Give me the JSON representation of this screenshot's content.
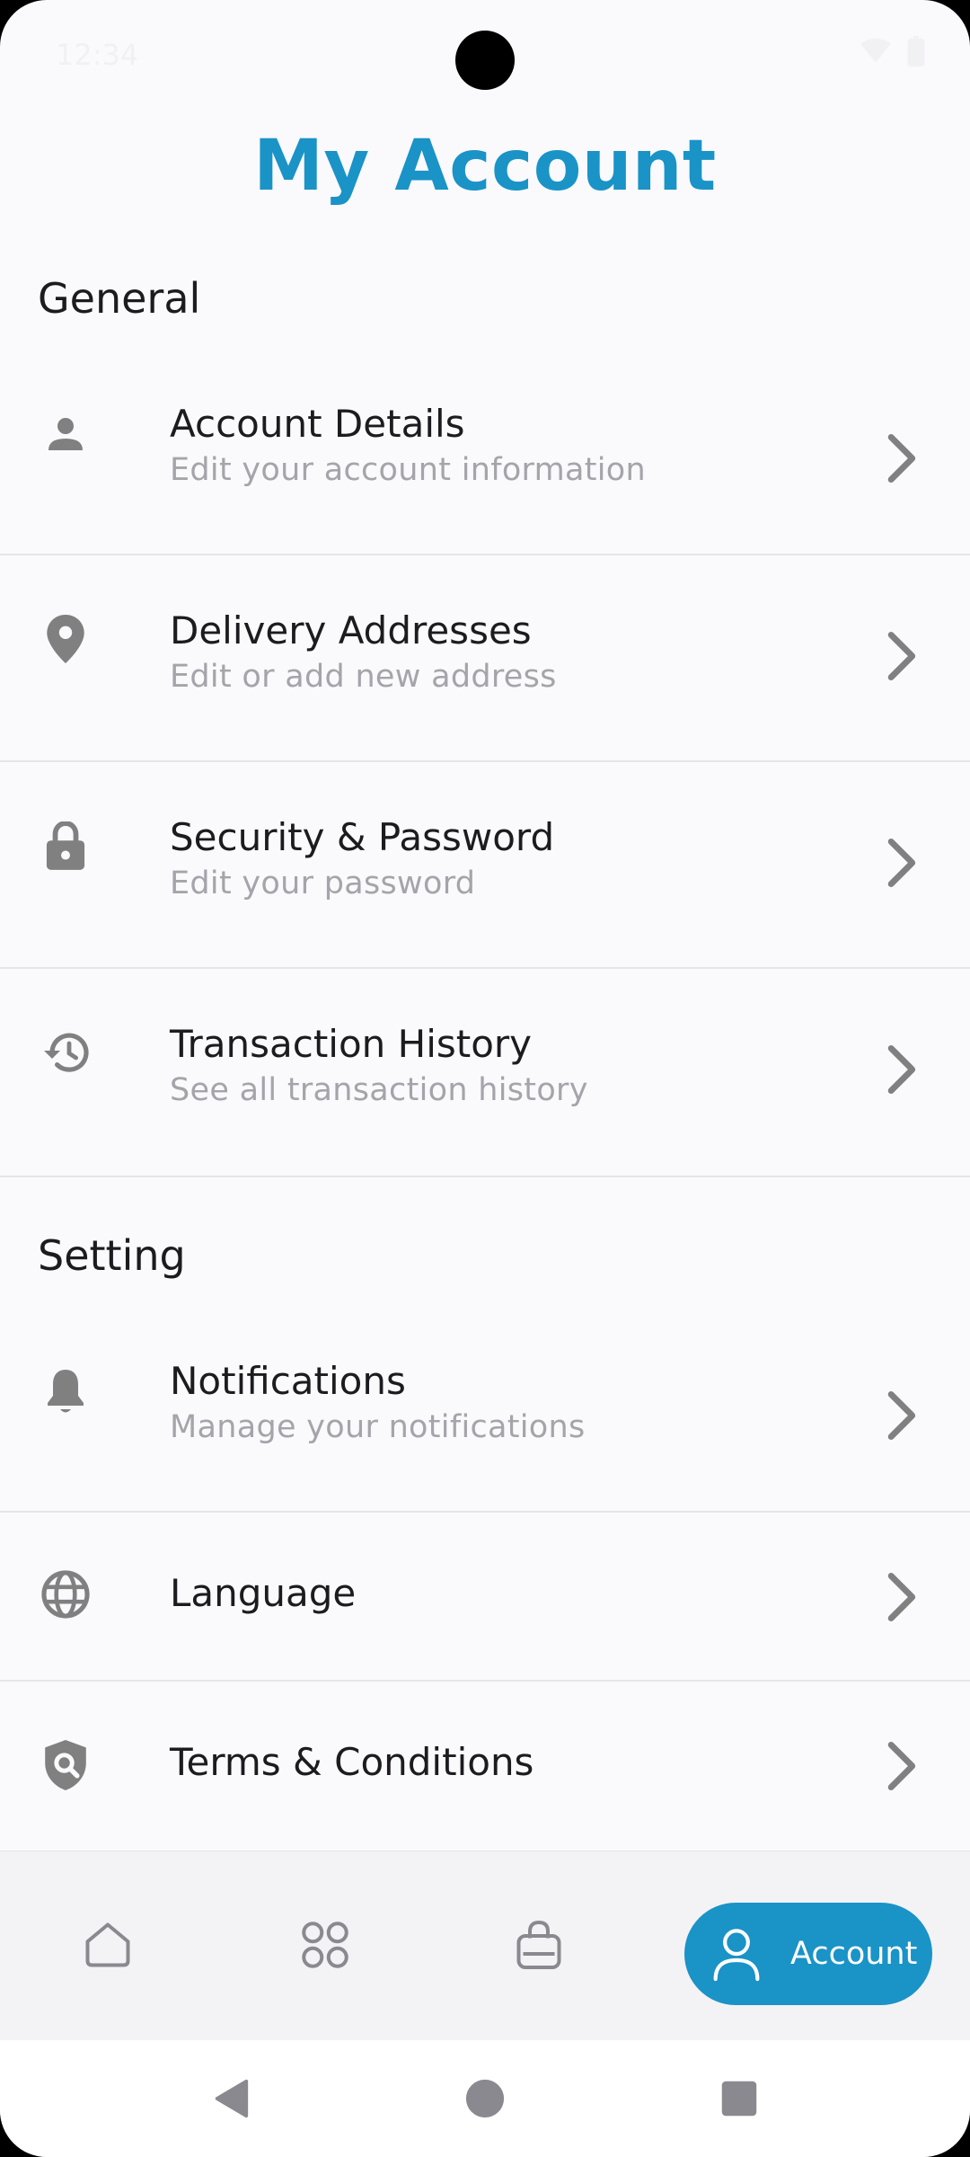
{
  "status_bar": {
    "time": "12:34"
  },
  "header": {
    "title": "My Account"
  },
  "sections": {
    "general": {
      "title": "General",
      "items": [
        {
          "title": "Account Details",
          "subtitle": "Edit your account information",
          "icon": "person-icon"
        },
        {
          "title": "Delivery Addresses",
          "subtitle": "Edit or add new address",
          "icon": "location-pin-icon"
        },
        {
          "title": "Security & Password",
          "subtitle": "Edit your password",
          "icon": "lock-icon"
        },
        {
          "title": "Transaction History",
          "subtitle": "See all transaction history",
          "icon": "history-icon"
        }
      ]
    },
    "setting": {
      "title": "Setting",
      "items": [
        {
          "title": "Notifications",
          "subtitle": "Manage your notifications",
          "icon": "bell-icon"
        },
        {
          "title": "Language",
          "icon": "globe-icon"
        },
        {
          "title": "Terms & Conditions",
          "icon": "shield-search-icon"
        }
      ]
    }
  },
  "bottom_nav": {
    "items": [
      {
        "icon": "home-icon"
      },
      {
        "icon": "grid-icon"
      },
      {
        "icon": "shopping-bag-icon"
      },
      {
        "icon": "person-outline-icon",
        "label": "Account",
        "active": true
      }
    ]
  },
  "system_nav": {
    "items": [
      {
        "icon": "back-triangle-icon"
      },
      {
        "icon": "home-circle-icon"
      },
      {
        "icon": "recents-square-icon"
      }
    ]
  },
  "colors": {
    "accent": "#1a93c7",
    "background": "#faf9fc",
    "text_primary": "#1c1b1f",
    "text_secondary": "#a5a4aa",
    "icon_gray": "#808080",
    "divider": "#e5e4e8"
  }
}
